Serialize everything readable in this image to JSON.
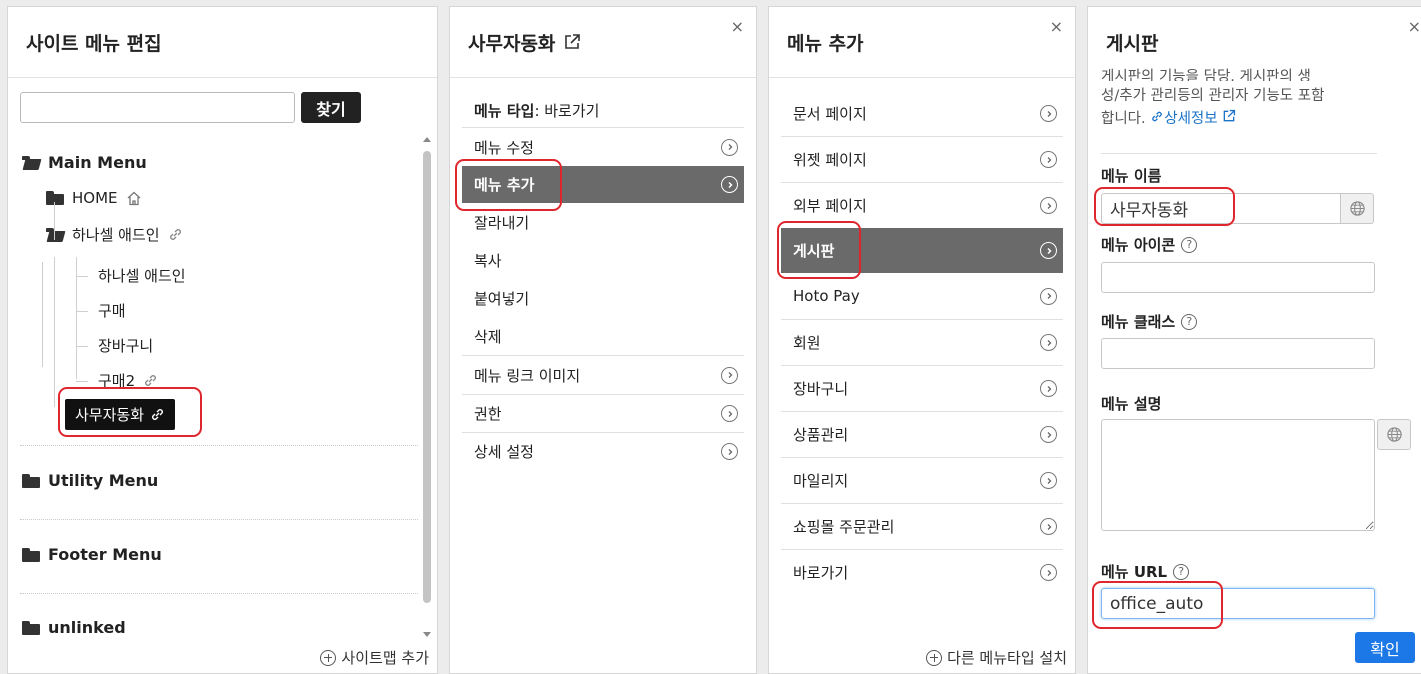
{
  "panel1": {
    "title": "사이트 메뉴 편집",
    "search_placeholder": "",
    "find_label": "찾기",
    "tree": {
      "main": "Main Menu",
      "home": "HOME",
      "hanasel": "하나셀 애드인",
      "children": [
        "하나셀 애드인",
        "구매",
        "장바구니",
        "구매2"
      ],
      "selected": "사무자동화",
      "utility": "Utility Menu",
      "footer": "Footer Menu",
      "unlinked": "unlinked"
    },
    "add_sitemap": "사이트맵 추가"
  },
  "panel2": {
    "title": "사무자동화",
    "menu_type_label": "메뉴 타입",
    "menu_type_value": ": 바로가기",
    "items": [
      "메뉴 수정",
      "메뉴 추가",
      "잘라내기",
      "복사",
      "붙여넣기",
      "삭제",
      "메뉴 링크 이미지",
      "권한",
      "상세 설정"
    ],
    "close": "×"
  },
  "panel3": {
    "title": "메뉴 추가",
    "items": [
      "문서 페이지",
      "위젯 페이지",
      "외부 페이지",
      "게시판",
      "Hoto Pay",
      "회원",
      "장바구니",
      "상품관리",
      "마일리지",
      "쇼핑몰 주문관리",
      "바로가기"
    ],
    "other_type": "다른 메뉴타입 설치",
    "close": "×"
  },
  "panel4": {
    "title": "게시판",
    "desc_line1": "게시판의 기능을 담당. 게시판의 생",
    "desc_line2": "성/추가 관리등의 관리자 기능도 포함",
    "desc_line3": "합니다.",
    "detail_link": "상세정보",
    "menu_name_label": "메뉴 이름",
    "menu_name_value": "사무자동화",
    "menu_icon_label": "메뉴 아이콘",
    "menu_class_label": "메뉴 클래스",
    "menu_desc_label": "메뉴 설명",
    "menu_url_label": "메뉴 URL",
    "menu_url_value": "office_auto",
    "confirm": "확인",
    "close": "×"
  }
}
